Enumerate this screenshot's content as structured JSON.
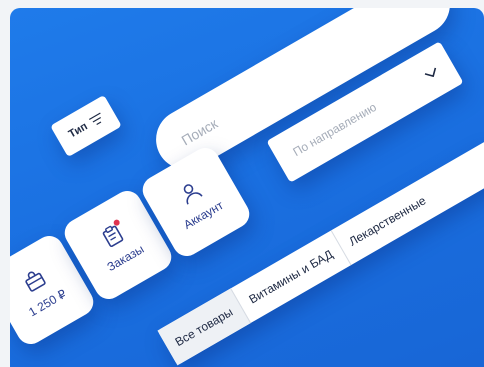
{
  "search": {
    "placeholder": "Поиск"
  },
  "type_filter": {
    "label": "Тип"
  },
  "direction_dropdown": {
    "placeholder": "По направлению"
  },
  "tiles": {
    "cart": {
      "label": "1 250 ₽",
      "icon": "shopping-bag-icon"
    },
    "orders": {
      "label": "Заказы",
      "icon": "clipboard-icon",
      "has_badge": true
    },
    "account": {
      "label": "Аккаунт",
      "icon": "user-icon"
    }
  },
  "categories": [
    {
      "label": "Все товары",
      "active": true
    },
    {
      "label": "Витамины и БАД"
    },
    {
      "label": "Лекарственные"
    }
  ],
  "colors": {
    "background_blue": "#1a6fe0",
    "text_dark": "#1f2a44",
    "tile_text": "#2c3e8f",
    "badge_red": "#e0334f"
  }
}
